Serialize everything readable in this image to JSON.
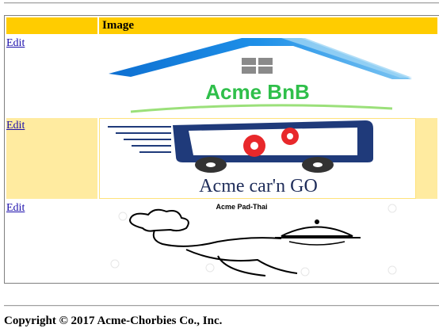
{
  "table": {
    "headers": [
      "",
      "Image"
    ],
    "rows": [
      {
        "edit_label": "Edit",
        "logo_text": "Acme BnB"
      },
      {
        "edit_label": "Edit",
        "logo_text": "Acme car'n GO"
      },
      {
        "edit_label": "Edit",
        "logo_text": "Acme Pad-Thai"
      }
    ]
  },
  "footer": {
    "copyright": "Copyright © 2017 Acme-Chorbies Co., Inc."
  },
  "colors": {
    "header_bg": "#ffcc00",
    "alt_row_bg": "#ffeba0",
    "bnb_blue": "#1e8fe0",
    "bnb_green": "#2fbf4a",
    "car_navy": "#1f3a7a",
    "car_red": "#e8282b"
  }
}
